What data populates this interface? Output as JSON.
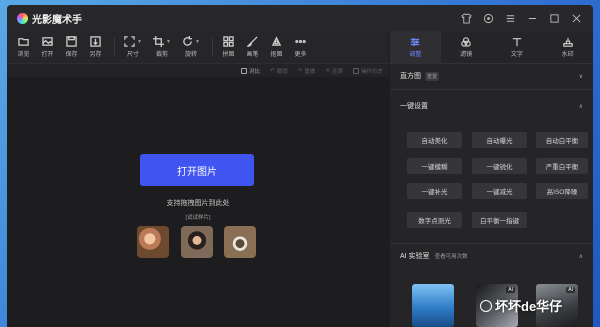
{
  "app": {
    "title": "光影魔术手"
  },
  "toolbar": {
    "tools": [
      {
        "label": "浏览",
        "icon": "folder-icon"
      },
      {
        "label": "打开",
        "icon": "open-image-icon"
      },
      {
        "label": "保存",
        "icon": "save-icon"
      },
      {
        "label": "另存",
        "icon": "save-as-icon"
      },
      {
        "label": "尺寸",
        "icon": "resize-icon"
      },
      {
        "label": "裁剪",
        "icon": "crop-icon"
      },
      {
        "label": "旋转",
        "icon": "rotate-icon"
      },
      {
        "label": "拼图",
        "icon": "collage-icon"
      },
      {
        "label": "画笔",
        "icon": "brush-icon"
      },
      {
        "label": "抠图",
        "icon": "cutout-icon"
      },
      {
        "label": "更多",
        "icon": "more-icon"
      }
    ]
  },
  "strip": {
    "compare": "对比",
    "undo": "撤销",
    "redo": "重做",
    "restore": "还原",
    "history": "操作历史"
  },
  "canvas": {
    "open_button": "打开图片",
    "drop_hint": "支持拖拽图片到此处",
    "trial_hint": "[试试样片]"
  },
  "right_panel": {
    "tabs": [
      {
        "label": "调整",
        "icon": "adjust-icon",
        "active": true
      },
      {
        "label": "滤镜",
        "icon": "filter-icon",
        "active": false
      },
      {
        "label": "文字",
        "icon": "text-icon",
        "active": false
      },
      {
        "label": "水印",
        "icon": "watermark-icon",
        "active": false
      }
    ],
    "histogram": {
      "title": "直方图",
      "badge": "重置"
    },
    "one_click": {
      "title": "一键设置",
      "buttons": [
        "自动美化",
        "自动曝光",
        "自动白平衡",
        "一键模糊",
        "一键锐化",
        "严重白平衡",
        "一键补光",
        "一键减光",
        "高ISO降噪",
        "数字点测光",
        "白平衡一指键"
      ]
    },
    "ai_lab": {
      "title": "AI 实验室",
      "sub": "查看可用次数",
      "tags": [
        "AI",
        "AI",
        "AI"
      ]
    }
  },
  "watermark_text": "坏坏de华仔",
  "colors": {
    "accent": "#3f54f0",
    "tab_active": "#6f86ff",
    "window_bg": "#1e1e20"
  }
}
